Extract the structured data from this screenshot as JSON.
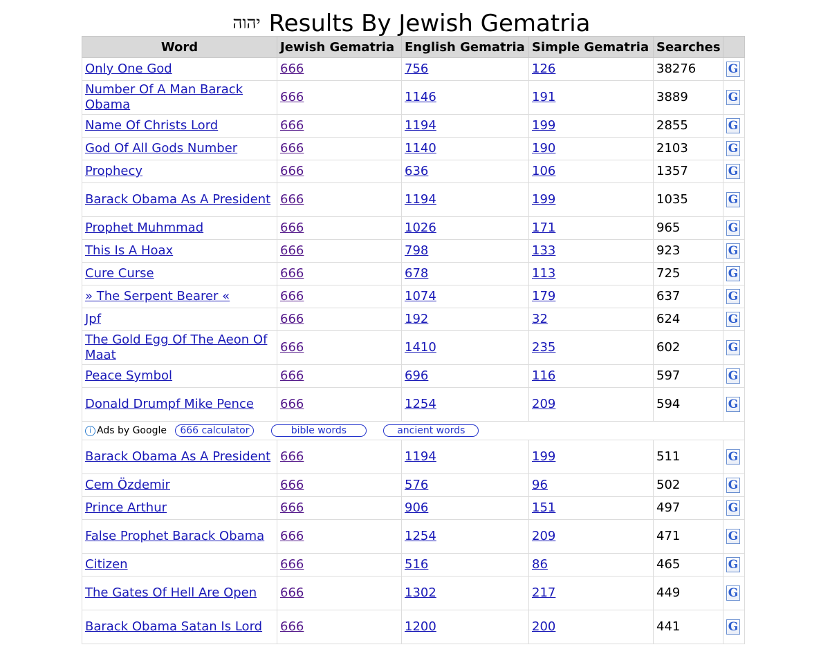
{
  "title": {
    "hebrew": "יהוה",
    "text": "Results By Jewish Gematria"
  },
  "columns": [
    "Word",
    "Jewish Gematria",
    "English Gematria",
    "Simple Gematria",
    "Searches"
  ],
  "rows": [
    {
      "word": "Only One God",
      "jewish": "666",
      "english": "756",
      "simple": "126",
      "searches": "38276"
    },
    {
      "word": "Number Of A Man Barack Obama",
      "jewish": "666",
      "english": "1146",
      "simple": "191",
      "searches": "3889"
    },
    {
      "word": "Name Of Christs Lord",
      "jewish": "666",
      "english": "1194",
      "simple": "199",
      "searches": "2855"
    },
    {
      "word": "God Of All Gods Number",
      "jewish": "666",
      "english": "1140",
      "simple": "190",
      "searches": "2103"
    },
    {
      "word": "Prophecy",
      "jewish": "666",
      "english": "636",
      "simple": "106",
      "searches": "1357"
    },
    {
      "word": "Barack Obama As A President",
      "jewish": "666",
      "english": "1194",
      "simple": "199",
      "searches": "1035"
    },
    {
      "word": "Prophet Muhmmad",
      "jewish": "666",
      "english": "1026",
      "simple": "171",
      "searches": "965"
    },
    {
      "word": "This Is A Hoax",
      "jewish": "666",
      "english": "798",
      "simple": "133",
      "searches": "923"
    },
    {
      "word": "Cure Curse",
      "jewish": "666",
      "english": "678",
      "simple": "113",
      "searches": "725"
    },
    {
      "word": "» The Serpent Bearer «",
      "jewish": "666",
      "english": "1074",
      "simple": "179",
      "searches": "637"
    },
    {
      "word": "Jpf",
      "jewish": "666",
      "english": "192",
      "simple": "32",
      "searches": "624"
    },
    {
      "word": "The Gold Egg Of The Aeon Of Maat",
      "jewish": "666",
      "english": "1410",
      "simple": "235",
      "searches": "602"
    },
    {
      "word": "Peace Symbol",
      "jewish": "666",
      "english": "696",
      "simple": "116",
      "searches": "597"
    },
    {
      "word": "Donald Drumpf Mike Pence",
      "jewish": "666",
      "english": "1254",
      "simple": "209",
      "searches": "594"
    }
  ],
  "ads": {
    "info_glyph": "i",
    "label": "Ads by Google",
    "links": [
      "666 calculator",
      "bible words",
      "ancient words"
    ]
  },
  "rows_after_ads": [
    {
      "word": "Barack Obama As A President",
      "jewish": "666",
      "english": "1194",
      "simple": "199",
      "searches": "511"
    },
    {
      "word": "Cem Özdemir",
      "jewish": "666",
      "english": "576",
      "simple": "96",
      "searches": "502"
    },
    {
      "word": "Prince Arthur",
      "jewish": "666",
      "english": "906",
      "simple": "151",
      "searches": "497"
    },
    {
      "word": "False Prophet Barack Obama",
      "jewish": "666",
      "english": "1254",
      "simple": "209",
      "searches": "471"
    },
    {
      "word": "Citizen",
      "jewish": "666",
      "english": "516",
      "simple": "86",
      "searches": "465"
    },
    {
      "word": "The Gates Of Hell Are Open",
      "jewish": "666",
      "english": "1302",
      "simple": "217",
      "searches": "449"
    },
    {
      "word": "Barack Obama Satan Is Lord",
      "jewish": "666",
      "english": "1200",
      "simple": "200",
      "searches": "441"
    }
  ],
  "google_icon_glyph": "G",
  "colors": {
    "header_bg": "#d9d9d9",
    "word_link": "#1a1ab8",
    "jewish_link_visited": "#551a8b"
  }
}
